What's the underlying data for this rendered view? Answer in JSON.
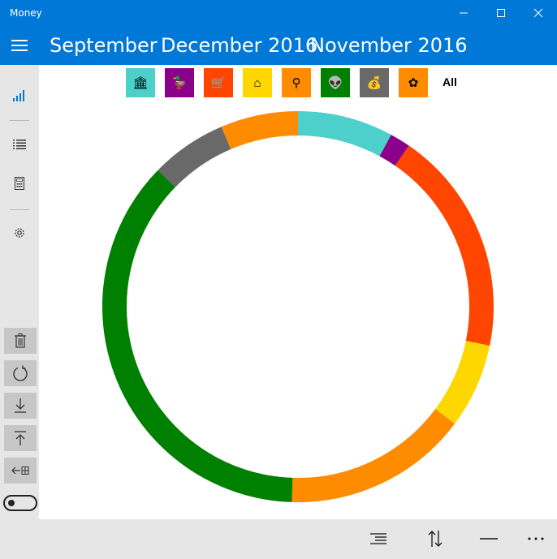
{
  "window": {
    "title": "Money"
  },
  "header": {
    "tabs": [
      "September",
      "December 2016",
      "November 2016"
    ]
  },
  "filters": {
    "all_label": "All",
    "categories": [
      {
        "icon": "bank-icon",
        "glyph": "🏛",
        "color": "#4dcfcc"
      },
      {
        "icon": "duck-icon",
        "glyph": "🦆",
        "color": "#8a008a"
      },
      {
        "icon": "cart-icon",
        "glyph": "🛒",
        "color": "#ff4500"
      },
      {
        "icon": "house-icon",
        "glyph": "⌂",
        "color": "#ffd700"
      },
      {
        "icon": "magnifier-icon",
        "glyph": "⚲",
        "color": "#ff8c00"
      },
      {
        "icon": "alien-icon",
        "glyph": "👽",
        "color": "#008000"
      },
      {
        "icon": "money-bag-icon",
        "glyph": "💰",
        "color": "#696969"
      },
      {
        "icon": "flower-icon",
        "glyph": "✿",
        "color": "#ff8c00"
      }
    ]
  },
  "chart_data": {
    "type": "pie",
    "style": "donut",
    "values": [
      {
        "color": "#4dcfcc",
        "value": 7.9
      },
      {
        "color": "#8a008a",
        "value": 1.7
      },
      {
        "color": "#ff4500",
        "value": 18.6
      },
      {
        "color": "#ffd700",
        "value": 7.0
      },
      {
        "color": "#ff8c00",
        "value": 15.3
      },
      {
        "color": "#008000",
        "value": 36.8
      },
      {
        "color": "#696969",
        "value": 6.3
      },
      {
        "color": "#ff8c00",
        "value": 6.4
      }
    ]
  },
  "toolbar": {
    "toggle_on": false
  }
}
